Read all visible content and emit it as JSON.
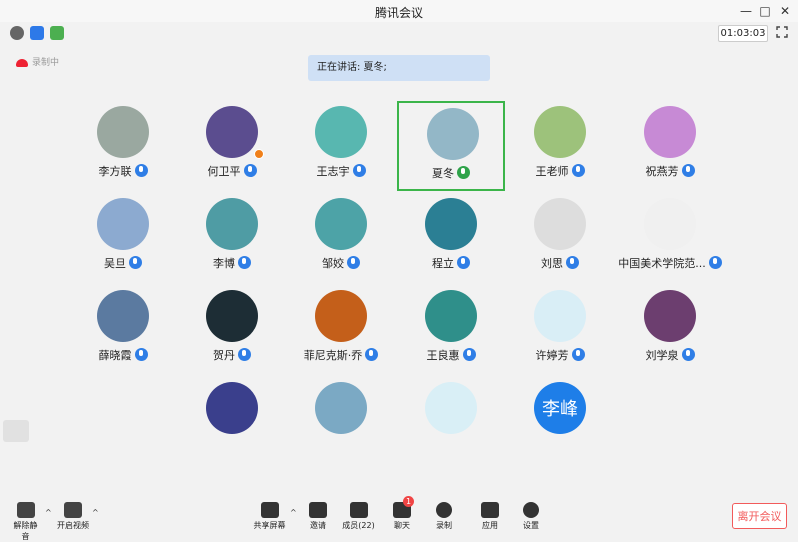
{
  "window": {
    "title": "腾讯会议"
  },
  "toolbar": {
    "timer": "01:03:03"
  },
  "status": {
    "recording_label": "录制中",
    "speaking_label": "正在讲话: 夏冬;"
  },
  "participants": [
    {
      "name": "李方联",
      "mic": "blue",
      "color": "#9aa8a0"
    },
    {
      "name": "何卫平",
      "mic": "blue",
      "color": "#5b4d8f"
    },
    {
      "name": "王志宇",
      "mic": "blue",
      "color": "#58b7b0"
    },
    {
      "name": "夏冬",
      "mic": "green",
      "color": "#93b7c7"
    },
    {
      "name": "王老师",
      "mic": "blue",
      "color": "#9dc27b"
    },
    {
      "name": "祝燕芳",
      "mic": "blue",
      "color": "#c78ad5"
    },
    {
      "name": "吴旦",
      "mic": "blue",
      "color": "#8caad0"
    },
    {
      "name": "李博",
      "mic": "blue",
      "color": "#4f9ca4"
    },
    {
      "name": "邹姣",
      "mic": "blue",
      "color": "#4da3a7"
    },
    {
      "name": "程立",
      "mic": "blue",
      "color": "#2b7f94"
    },
    {
      "name": "刘思",
      "mic": "blue",
      "color": "#ddd"
    },
    {
      "name": "中国美术学院范...",
      "mic": "blue",
      "color": "#f0f0f0"
    },
    {
      "name": "薛晓霞",
      "mic": "blue",
      "color": "#5b7aa0"
    },
    {
      "name": "贺丹",
      "mic": "blue",
      "color": "#1d2d35"
    },
    {
      "name": "菲尼克斯·乔",
      "mic": "blue",
      "color": "#c45f1a"
    },
    {
      "name": "王良惠",
      "mic": "blue",
      "color": "#2f8f8a"
    },
    {
      "name": "许婷芳",
      "mic": "blue",
      "color": "#d9eef6"
    },
    {
      "name": "刘学泉",
      "mic": "blue",
      "color": "#6c3e6f"
    },
    {
      "name": "",
      "mic": "",
      "color": "#3a3f8c"
    },
    {
      "name": "",
      "mic": "",
      "color": "#7ba9c4"
    },
    {
      "name": "",
      "mic": "",
      "color": "#d9eff6"
    },
    {
      "name": "",
      "mic": "",
      "color": "#1e7ee8",
      "initials": "李峰"
    }
  ],
  "bottom": {
    "mute": "解除静音",
    "video": "开启视频",
    "share": "共享屏幕",
    "invite": "邀请",
    "members": "成员(22)",
    "chat": "聊天",
    "chat_badge": "1",
    "record": "录制",
    "apps": "应用",
    "settings": "设置",
    "leave": "离开会议"
  }
}
